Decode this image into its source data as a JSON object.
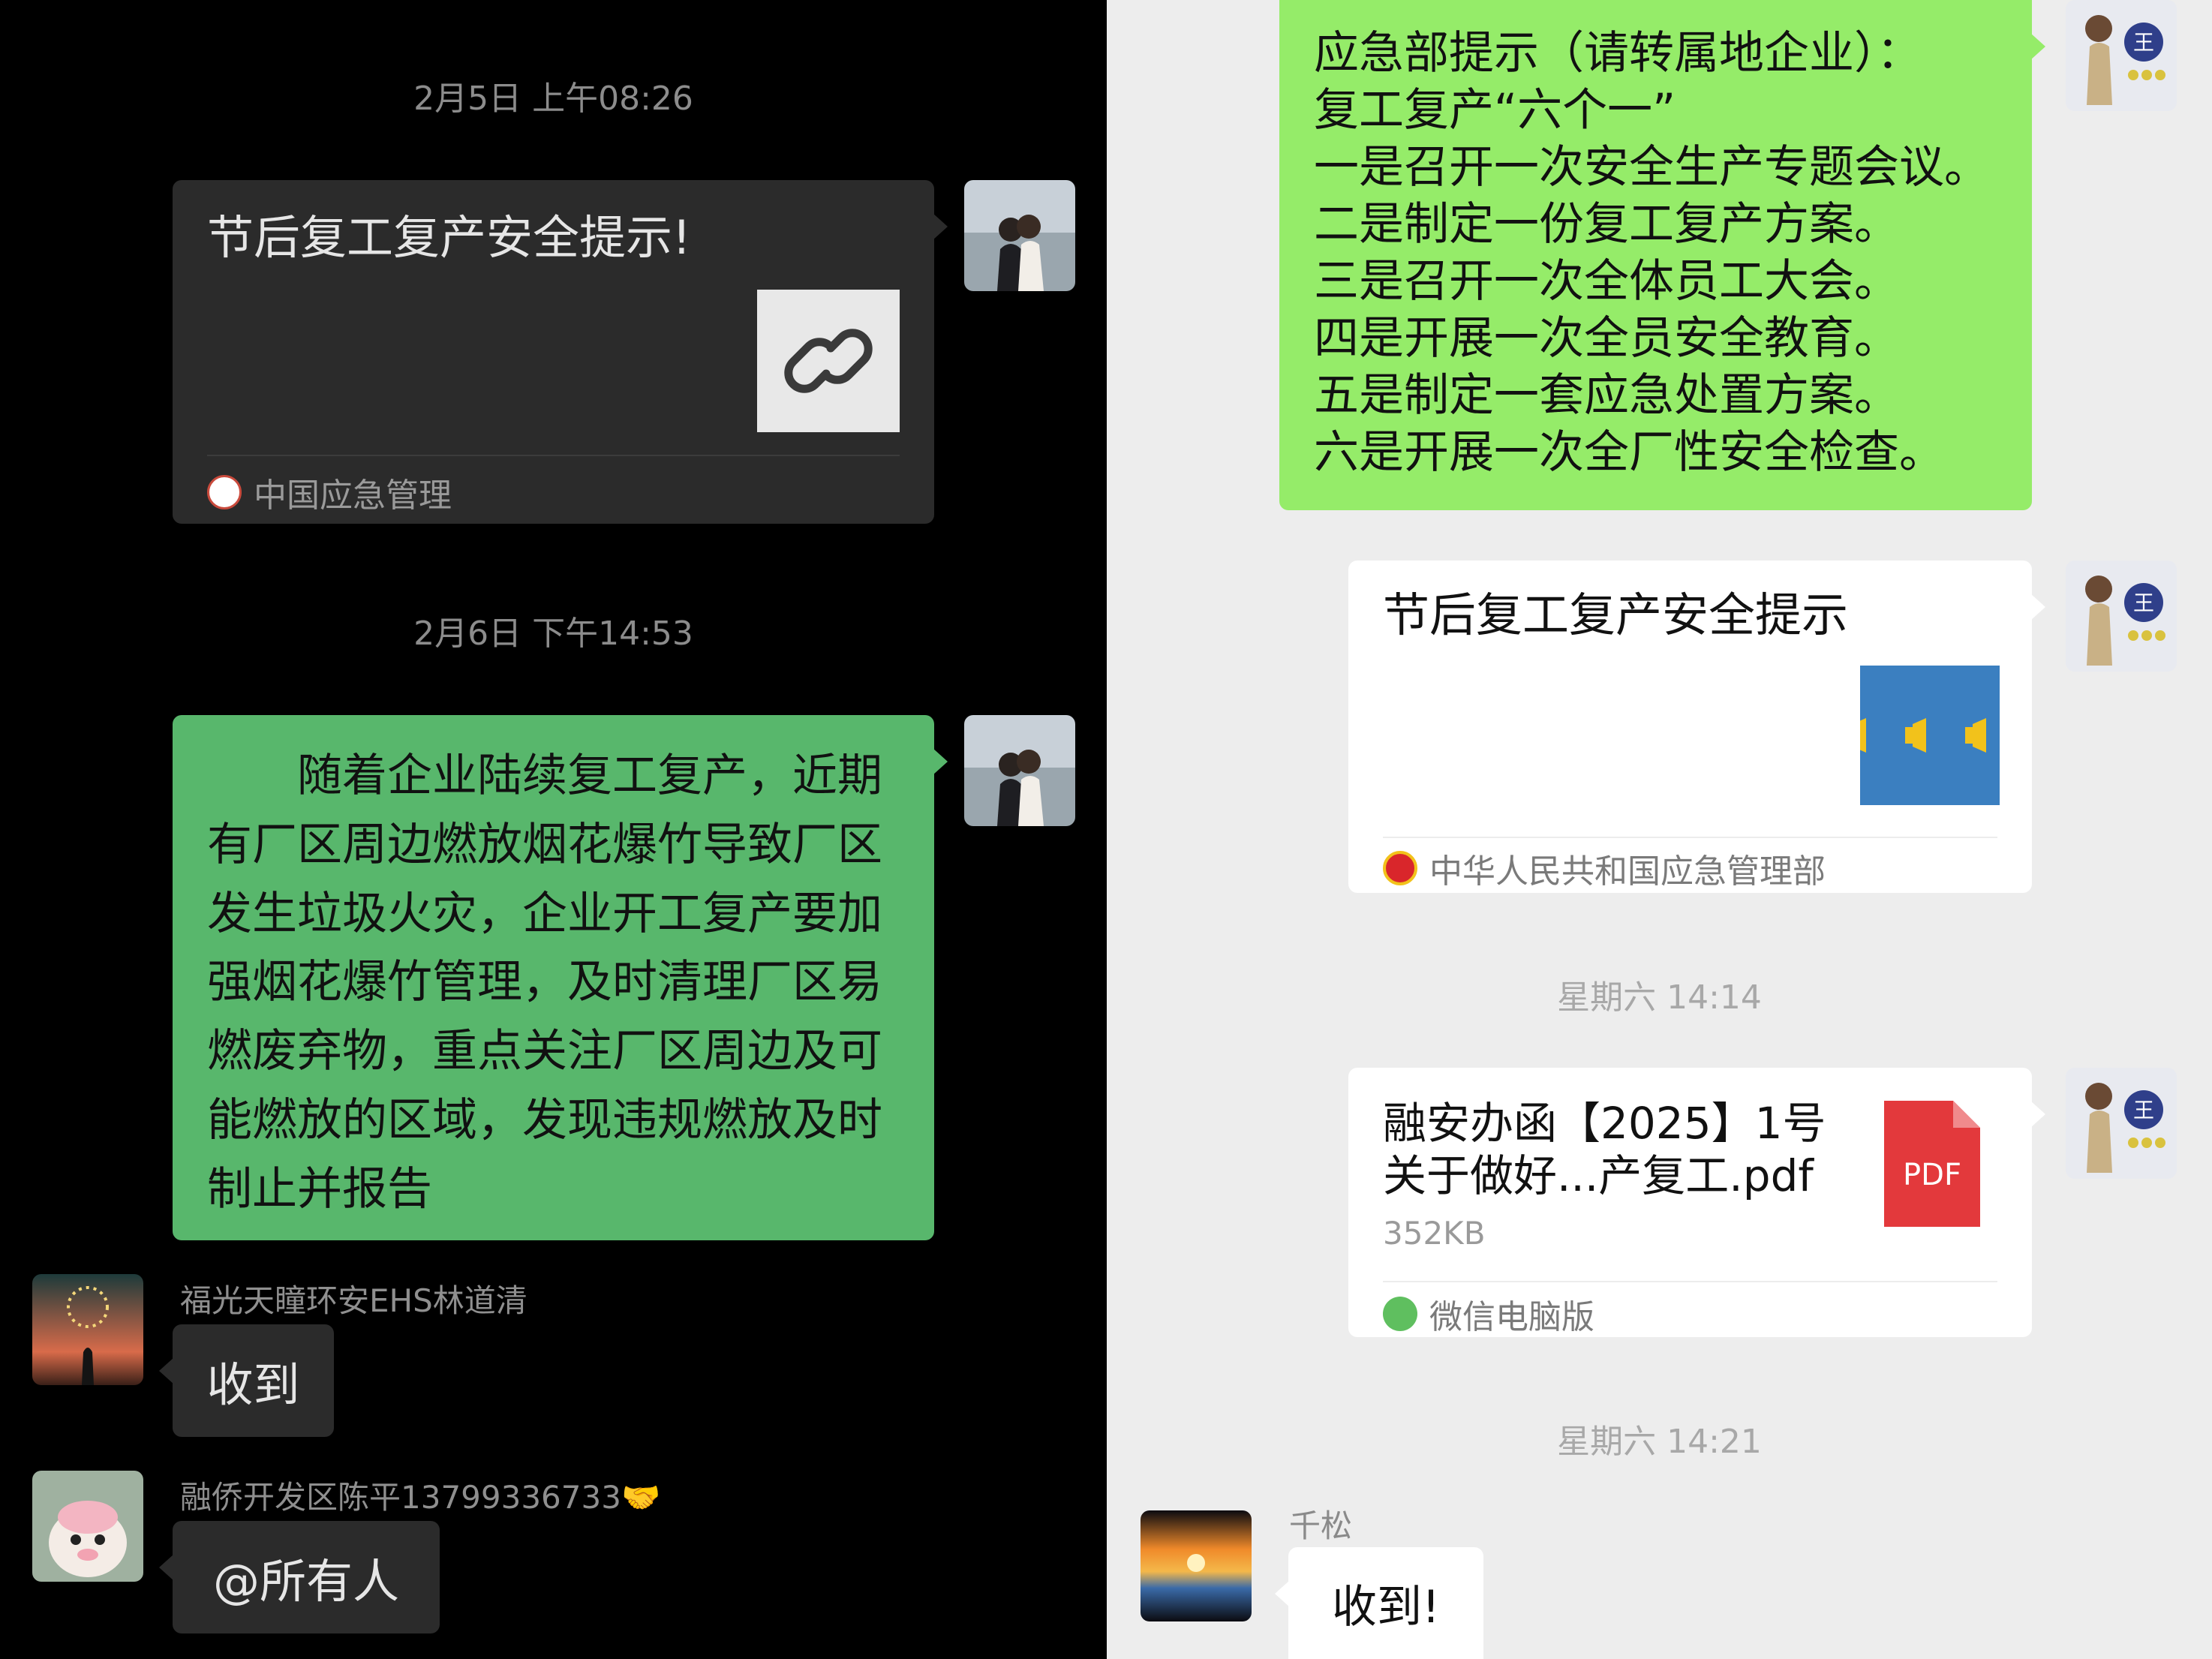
{
  "left": {
    "timestamps": [
      "2月5日 上午08:26",
      "2月6日 下午14:53"
    ],
    "link_card": {
      "title": "节后复工复产安全提示!",
      "source": "中国应急管理",
      "source_icon": "emergency-management-logo",
      "thumbnail_icon": "link-icon"
    },
    "notice_message": {
      "lines": [
        "　　随着企业陆续复工复产，近期",
        "有厂区周边燃放烟花爆竹导致厂区",
        "发生垃圾火灾，企业开工复产要加",
        "强烟花爆竹管理，及时清理厂区易",
        "燃废弃物，重点关注厂区周边及可",
        "能燃放的区域，发现违规燃放及时",
        "制止并报告"
      ],
      "bubble_color": "#58b76c"
    },
    "replies": [
      {
        "sender": "福光天瞳环安EHS林道清",
        "text": "收到"
      },
      {
        "sender": "融侨开发区陈平13799336733🤝",
        "text": "@所有人"
      }
    ]
  },
  "right": {
    "notice_message": {
      "lines": [
        "应急部提示（请转属地企业）：",
        "复工复产“六个一”",
        "一是召开一次安全生产专题会议。",
        "二是制定一份复工复产方案。",
        "三是召开一次全体员工大会。",
        "四是开展一次全员安全教育。",
        "五是制定一套应急处置方案。",
        "六是开展一次全厂性安全检查。"
      ],
      "bubble_color": "#95ec69"
    },
    "link_card": {
      "title": "节后复工复产安全提示",
      "source": "中华人民共和国应急管理部",
      "source_icon": "national-emblem-icon",
      "thumbnail_icon": "megaphone-icon"
    },
    "timestamps": [
      "星期六 14:14",
      "星期六 14:21"
    ],
    "file_card": {
      "name_lines": [
        "融安办函【2025】1号",
        "关于做好...产复工.pdf"
      ],
      "size": "352KB",
      "file_badge": "PDF",
      "source": "微信电脑版",
      "source_icon": "wechat-icon"
    },
    "reply": {
      "sender": "千松",
      "text": "收到!"
    }
  }
}
